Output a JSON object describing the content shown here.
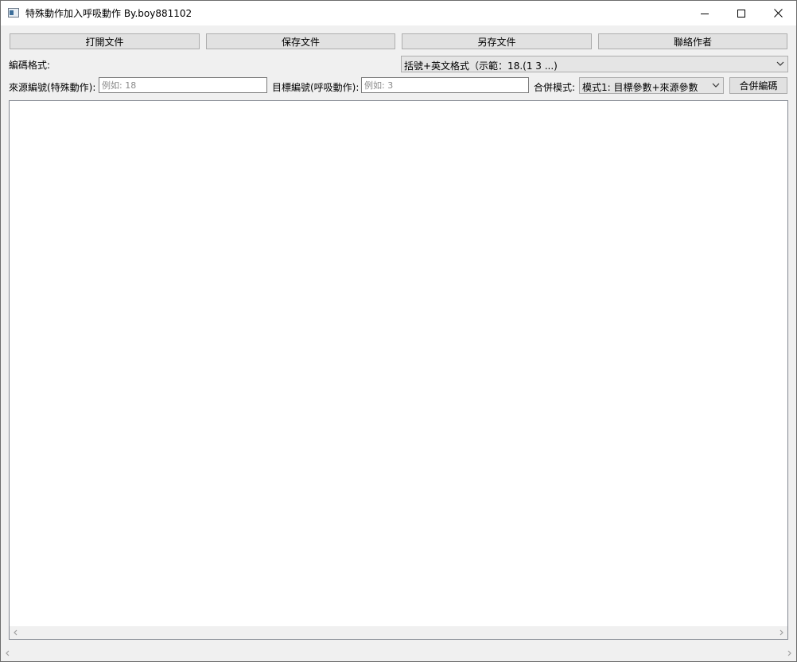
{
  "window": {
    "title": "特殊動作加入呼吸動作  By.boy881102"
  },
  "toolbar": {
    "open_label": "打開文件",
    "save_label": "保存文件",
    "save_as_label": "另存文件",
    "contact_label": "聯絡作者"
  },
  "encoding": {
    "label": "編碼格式:",
    "selected": "括號+英文格式（示範：18.(1 3 ...)"
  },
  "merge_row": {
    "source_label": "來源編號(特殊動作):",
    "source_placeholder": "例如: 18",
    "source_value": "",
    "target_label": "目標編號(呼吸動作):",
    "target_placeholder": "例如: 3",
    "target_value": "",
    "mode_label": "合併模式:",
    "mode_selected": "模式1: 目標參數+來源參數",
    "merge_button": "合併編碼"
  },
  "icons": {
    "app": "app-window-icon",
    "minimize": "minimize-icon",
    "maximize": "maximize-icon",
    "close": "close-icon",
    "dropdown": "chevron-down-icon",
    "scroll_left": "scroll-left-arrow-icon",
    "scroll_right": "scroll-right-arrow-icon"
  },
  "colors": {
    "window_bg": "#f0f0f0",
    "button_bg": "#e1e1e1",
    "button_border": "#adadad",
    "editor_bg": "#ffffff"
  }
}
